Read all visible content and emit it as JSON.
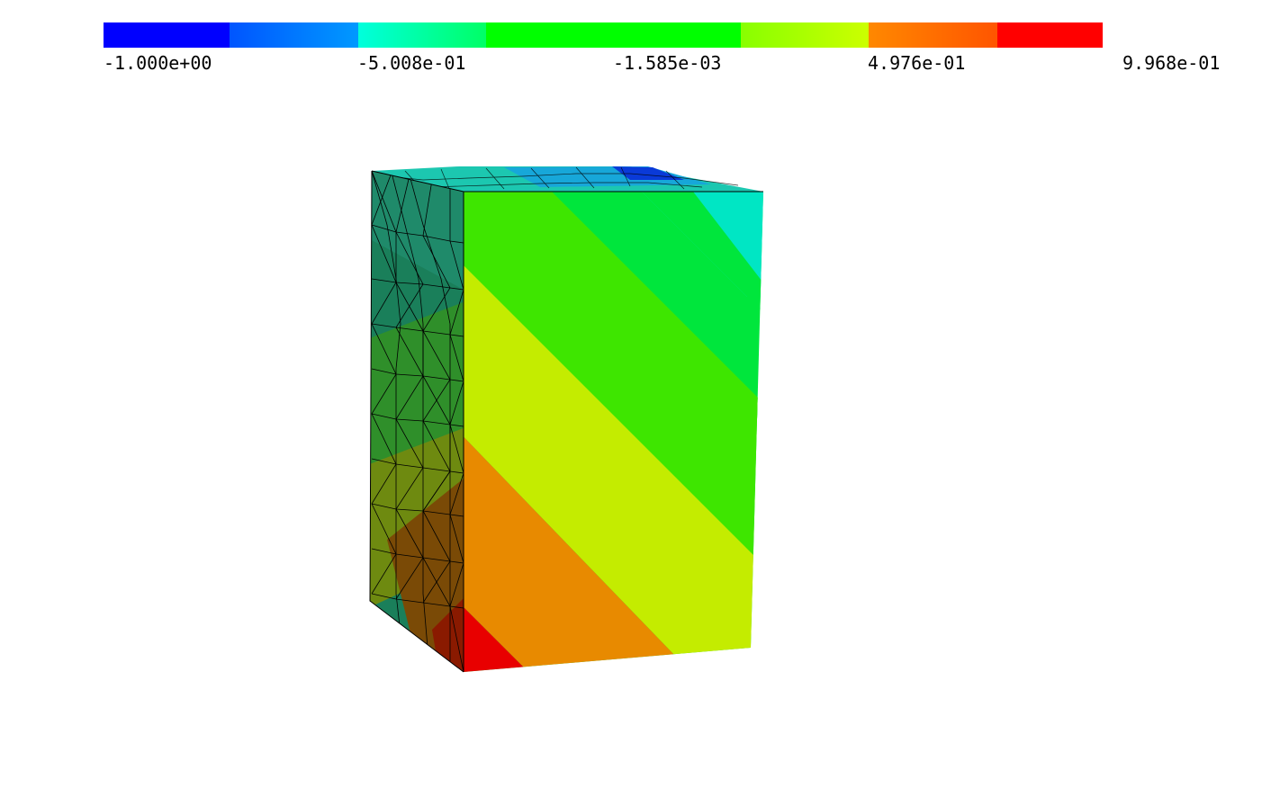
{
  "legend": {
    "colors": [
      "#0000ff",
      "#0066ff",
      "#00ffcc",
      "#00ff00",
      "#ccff00",
      "#ff8800",
      "#ff0000"
    ],
    "gradient_stops": [
      [
        "#0000ff",
        "#0000ff"
      ],
      [
        "#0055ff",
        "#0099ff"
      ],
      [
        "#00ffdd",
        "#00ff66"
      ],
      [
        "#00ff00",
        "#00ff00"
      ],
      [
        "#88ff00",
        "#ccff00"
      ],
      [
        "#ff8800",
        "#ff5500"
      ],
      [
        "#ff0000",
        "#ff0000"
      ]
    ],
    "ticks": [
      "-1.000e+00",
      "-5.008e-01",
      "-1.585e-03",
      "4.976e-01",
      "9.968e-01"
    ]
  },
  "model": {
    "front_band_colors": [
      "#ff0000",
      "#ff8800",
      "#ccff00",
      "#00ff00",
      "#00ff66",
      "#00ffcc"
    ],
    "side_face_color": "#2e8b57",
    "top_face_color": "#3aa0d0"
  }
}
